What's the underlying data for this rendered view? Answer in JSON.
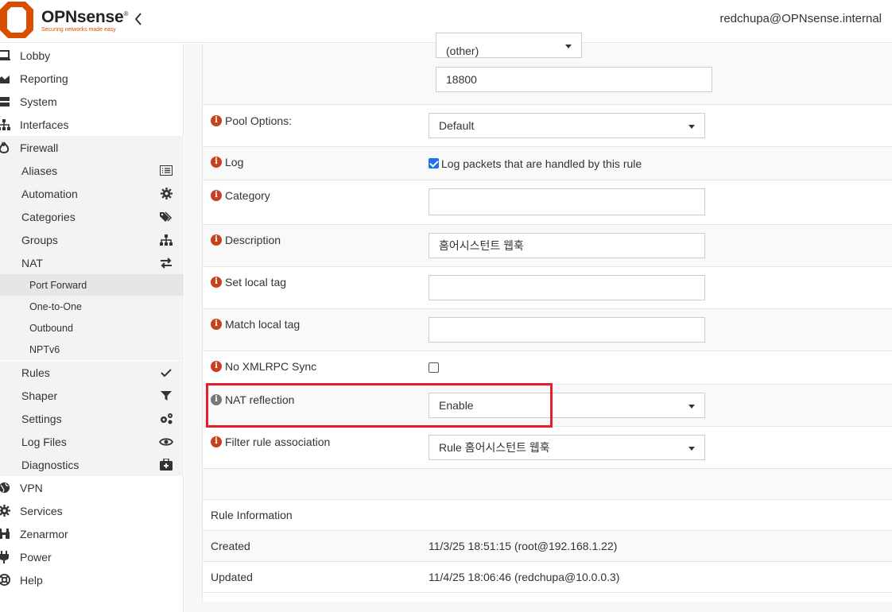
{
  "header": {
    "brand": "OPNsense",
    "brand_mark": "®",
    "tagline": "Securing networks made easy",
    "user": "redchupa@OPNsense.internal"
  },
  "sidebar": {
    "items": [
      {
        "label": "Lobby",
        "icon": "laptop-icon"
      },
      {
        "label": "Reporting",
        "icon": "area-chart-icon"
      },
      {
        "label": "System",
        "icon": "server-icon"
      },
      {
        "label": "Interfaces",
        "icon": "sitemap-icon"
      },
      {
        "label": "Firewall",
        "icon": "fire-icon"
      }
    ],
    "firewall_sub": [
      {
        "label": "Aliases",
        "icon": "list-icon"
      },
      {
        "label": "Automation",
        "icon": "gear-icon"
      },
      {
        "label": "Categories",
        "icon": "tags-icon"
      },
      {
        "label": "Groups",
        "icon": "sitemap-icon"
      },
      {
        "label": "NAT",
        "icon": "exchange-icon"
      }
    ],
    "nat_sub": [
      {
        "label": "Port Forward"
      },
      {
        "label": "One-to-One"
      },
      {
        "label": "Outbound"
      },
      {
        "label": "NPTv6"
      }
    ],
    "firewall_sub2": [
      {
        "label": "Rules",
        "icon": "check-icon"
      },
      {
        "label": "Shaper",
        "icon": "filter-icon"
      },
      {
        "label": "Settings",
        "icon": "gears-icon"
      },
      {
        "label": "Log Files",
        "icon": "eye-icon"
      },
      {
        "label": "Diagnostics",
        "icon": "medkit-icon"
      }
    ],
    "items_bottom": [
      {
        "label": "VPN",
        "icon": "globe-icon"
      },
      {
        "label": "Services",
        "icon": "cog-icon"
      },
      {
        "label": "Zenarmor",
        "icon": "binoculars-icon"
      },
      {
        "label": "Power",
        "icon": "plug-icon"
      },
      {
        "label": "Help",
        "icon": "help-icon"
      }
    ]
  },
  "form": {
    "port_select": "(other)",
    "port_value": "18800",
    "pool_options_label": "Pool Options:",
    "pool_options_value": "Default",
    "log_label": "Log",
    "log_checkbox_label": "Log packets that are handled by this rule",
    "category_label": "Category",
    "category_value": "",
    "description_label": "Description",
    "description_value": "홈어시스턴트 웹훅",
    "set_local_tag_label": "Set local tag",
    "set_local_tag_value": "",
    "match_local_tag_label": "Match local tag",
    "match_local_tag_value": "",
    "no_xmlrpc_label": "No XMLRPC Sync",
    "nat_reflection_label": "NAT reflection",
    "nat_reflection_value": "Enable",
    "filter_rule_label": "Filter rule association",
    "filter_rule_value": "Rule 홈어시스턴트 웹훅"
  },
  "rule_info": {
    "title": "Rule Information",
    "created_label": "Created",
    "created_value": "11/3/25 18:51:15 (root@192.168.1.22)",
    "updated_label": "Updated",
    "updated_value": "11/4/25 18:06:46 (redchupa@10.0.0.3)"
  },
  "colors": {
    "brand": "#d94f00",
    "info_icon": "#c7411e",
    "highlight": "#e4202a",
    "checkbox": "#1a73e8"
  }
}
